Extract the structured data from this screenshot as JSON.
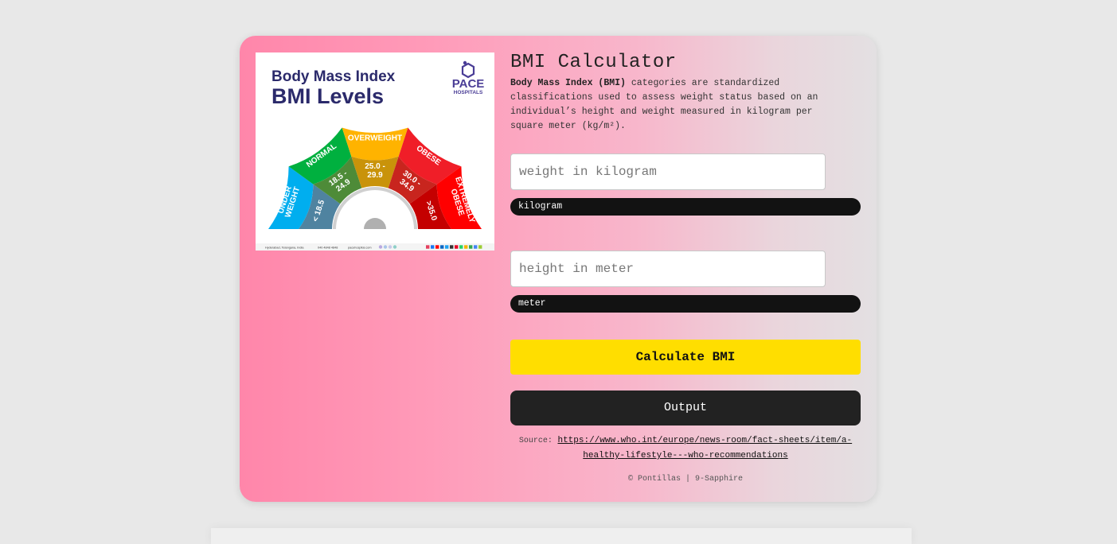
{
  "app": {
    "title": "BMI Calculator",
    "description_lead": "Body Mass Index (BMI)",
    "description_rest": " categories are standardized classifications used to assess weight status based on an individual’s height and weight measured in kilogram per square meter (kg/m²)."
  },
  "poster": {
    "heading_line1": "Body Mass Index",
    "heading_line2": "BMI Levels",
    "brand": "PACE",
    "brand_sub": "HOSPITALS",
    "categories": [
      {
        "name": "UNDER WEIGHT",
        "range": "< 18.5",
        "color": "#00aeef"
      },
      {
        "name": "NORMAL",
        "range": "18.5 - 24.9",
        "color": "#00b03f"
      },
      {
        "name": "OVERWEIGHT",
        "range": "25.0 - 29.9",
        "color": "#ffb300"
      },
      {
        "name": "OBESE",
        "range": "30.0 - 34.9",
        "color": "#f01e28"
      },
      {
        "name": "EXTREMELY OBESE",
        "range": ">35.0",
        "color": "#ff0000"
      }
    ],
    "footer_location": "Hyderabad, Telangana, India",
    "footer_phone": "040 4848 4848",
    "footer_site": "pacehospital.com"
  },
  "form": {
    "weight_placeholder": "weight in kilogram",
    "weight_value": "",
    "weight_unit": "kilogram",
    "height_placeholder": "height in meter",
    "height_value": "",
    "height_unit": "meter",
    "calculate_label": "Calculate BMI",
    "output_label": "Output"
  },
  "source": {
    "label": "Source:",
    "url": "https://www.who.int/europe/news-room/fact-sheets/item/a-healthy-lifestyle---who-recommendations"
  },
  "footer": {
    "text": "© Pontillas | 9-Sapphire"
  },
  "colors": {
    "accent_button": "#ffde00",
    "output_bg": "#222222",
    "unit_bg": "#121212",
    "poster_heading": "#2b2a6b"
  }
}
